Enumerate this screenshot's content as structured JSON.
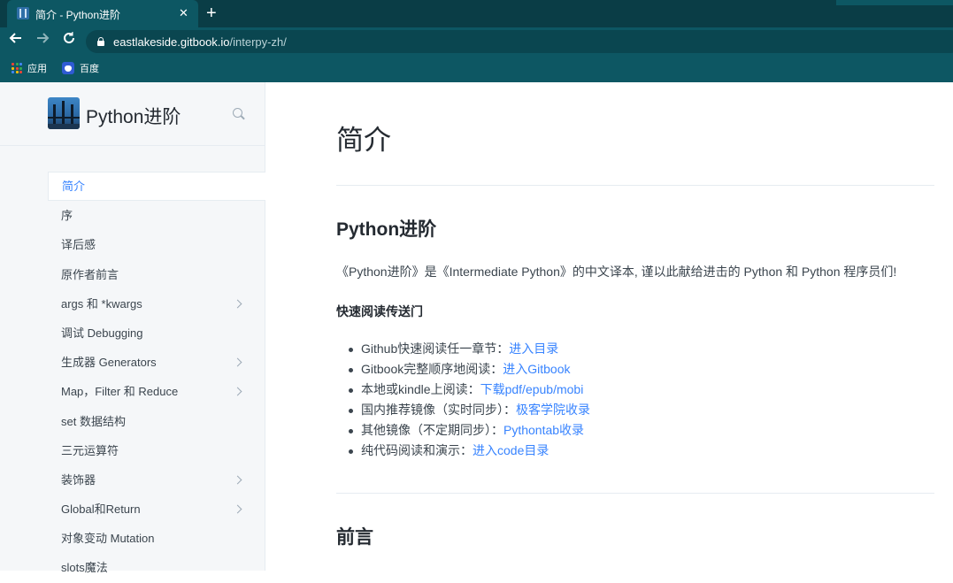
{
  "browser": {
    "tab_title": "简介 - Python进阶",
    "tab_close": "✕",
    "new_tab": "+",
    "url_host": "eastlakeside.gitbook.io",
    "url_path": "/interpy-zh/",
    "bookmarks": [
      {
        "label": "应用",
        "icon": "apps-grid-icon"
      },
      {
        "label": "百度",
        "icon": "baidu-icon"
      }
    ]
  },
  "sidebar": {
    "brand_title": "Python进阶",
    "items": [
      {
        "label": "简介",
        "active": true,
        "expandable": false
      },
      {
        "label": "序",
        "active": false,
        "expandable": false
      },
      {
        "label": "译后感",
        "active": false,
        "expandable": false
      },
      {
        "label": "原作者前言",
        "active": false,
        "expandable": false
      },
      {
        "label": "args 和 *kwargs",
        "active": false,
        "expandable": true
      },
      {
        "label": "调试 Debugging",
        "active": false,
        "expandable": false
      },
      {
        "label": "生成器 Generators",
        "active": false,
        "expandable": true
      },
      {
        "label": "Map，Filter 和 Reduce",
        "active": false,
        "expandable": true
      },
      {
        "label": "set 数据结构",
        "active": false,
        "expandable": false
      },
      {
        "label": "三元运算符",
        "active": false,
        "expandable": false
      },
      {
        "label": "装饰器",
        "active": false,
        "expandable": true
      },
      {
        "label": "Global和Return",
        "active": false,
        "expandable": true
      },
      {
        "label": "对象变动 Mutation",
        "active": false,
        "expandable": false
      },
      {
        "label": "slots魔法",
        "active": false,
        "expandable": false
      }
    ]
  },
  "main": {
    "title": "简介",
    "section1_heading": "Python进阶",
    "intro": "《Python进阶》是《Intermediate Python》的中文译本, 谨以此献给进击的 Python 和 Python 程序员们!",
    "quick_title": "快速阅读传送门",
    "links": [
      {
        "text": "Github快速阅读任一章节：",
        "link": "进入目录"
      },
      {
        "text": "Gitbook完整顺序地阅读：",
        "link": "进入Gitbook"
      },
      {
        "text": "本地或kindle上阅读：",
        "link": "下载pdf/epub/mobi"
      },
      {
        "text": "国内推荐镜像（实时同步）：",
        "link": "极客学院收录"
      },
      {
        "text": "其他镜像（不定期同步）：",
        "link": "Pythontab收录"
      },
      {
        "text": "纯代码阅读和演示：",
        "link": "进入code目录"
      }
    ],
    "section2_heading": "前言"
  },
  "colors": {
    "chrome": "#0d5763",
    "chrome_dark": "#0a3d46",
    "link": "#3884ff",
    "sidebar_bg": "#f5f7f9",
    "text": "#3b454e"
  }
}
